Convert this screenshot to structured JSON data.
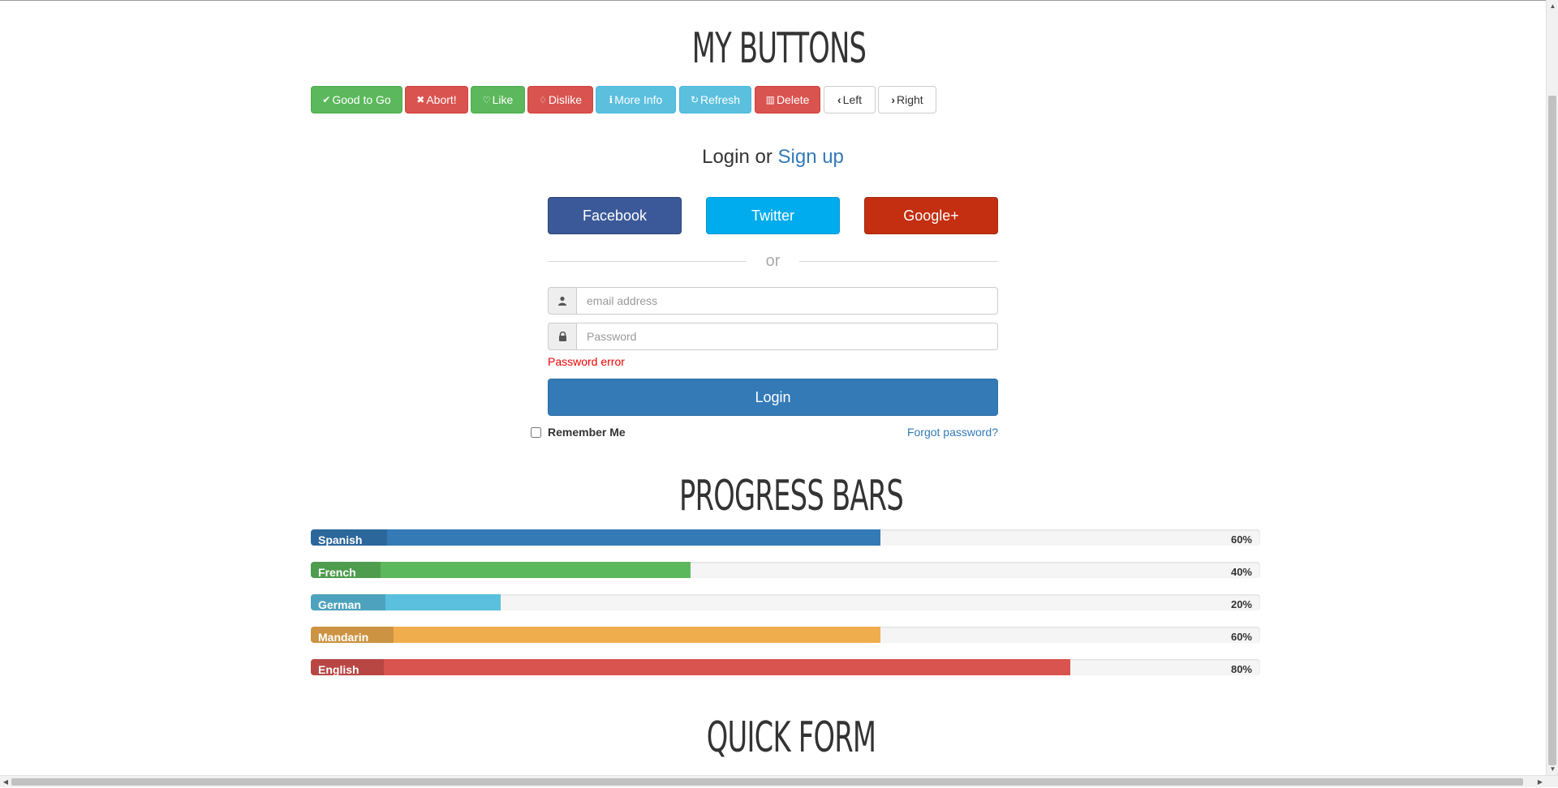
{
  "headings": {
    "buttons": "MY BUTTONS",
    "progress": "PROGRESS BARS",
    "quick_form": "QUICK FORM"
  },
  "buttons": [
    {
      "label": "Good to Go",
      "icon": "check-icon",
      "glyph": "✔",
      "style": "success"
    },
    {
      "label": "Abort!",
      "icon": "remove-icon",
      "glyph": "✖",
      "style": "danger"
    },
    {
      "label": "Like",
      "icon": "thumbs-up-icon",
      "glyph": "👍",
      "style": "success"
    },
    {
      "label": "Dislike",
      "icon": "thumbs-down-icon",
      "glyph": "👎",
      "style": "danger"
    },
    {
      "label": "More Info",
      "icon": "info-sign-icon",
      "glyph": "ℹ",
      "style": "info"
    },
    {
      "label": "Refresh",
      "icon": "refresh-icon",
      "glyph": "↻",
      "style": "info"
    },
    {
      "label": "Delete",
      "icon": "trash-icon",
      "glyph": "🗑",
      "style": "danger"
    },
    {
      "label": "Left",
      "icon": "chevron-left-icon",
      "glyph": "‹",
      "style": "default"
    },
    {
      "label": "Right",
      "icon": "chevron-right-icon",
      "glyph": "›",
      "style": "default"
    }
  ],
  "login": {
    "heading_prefix": "Login or",
    "signup_link": "Sign up",
    "social": {
      "facebook": "Facebook",
      "twitter": "Twitter",
      "google": "Google+"
    },
    "divider": "or",
    "email_placeholder": "email address",
    "password_placeholder": "Password",
    "password_error": "Password error",
    "login_button": "Login",
    "remember_me": "Remember Me",
    "forgot_password": "Forgot password?"
  },
  "progress_bars": [
    {
      "label": "Spanish",
      "value": 60,
      "display": "60%",
      "color": "#337ab7"
    },
    {
      "label": "French",
      "value": 40,
      "display": "40%",
      "color": "#5cb85c"
    },
    {
      "label": "German",
      "value": 20,
      "display": "20%",
      "color": "#5bc0de"
    },
    {
      "label": "Mandarin",
      "value": 60,
      "display": "60%",
      "color": "#f0ad4e"
    },
    {
      "label": "English",
      "value": 80,
      "display": "80%",
      "color": "#d9534f"
    }
  ]
}
